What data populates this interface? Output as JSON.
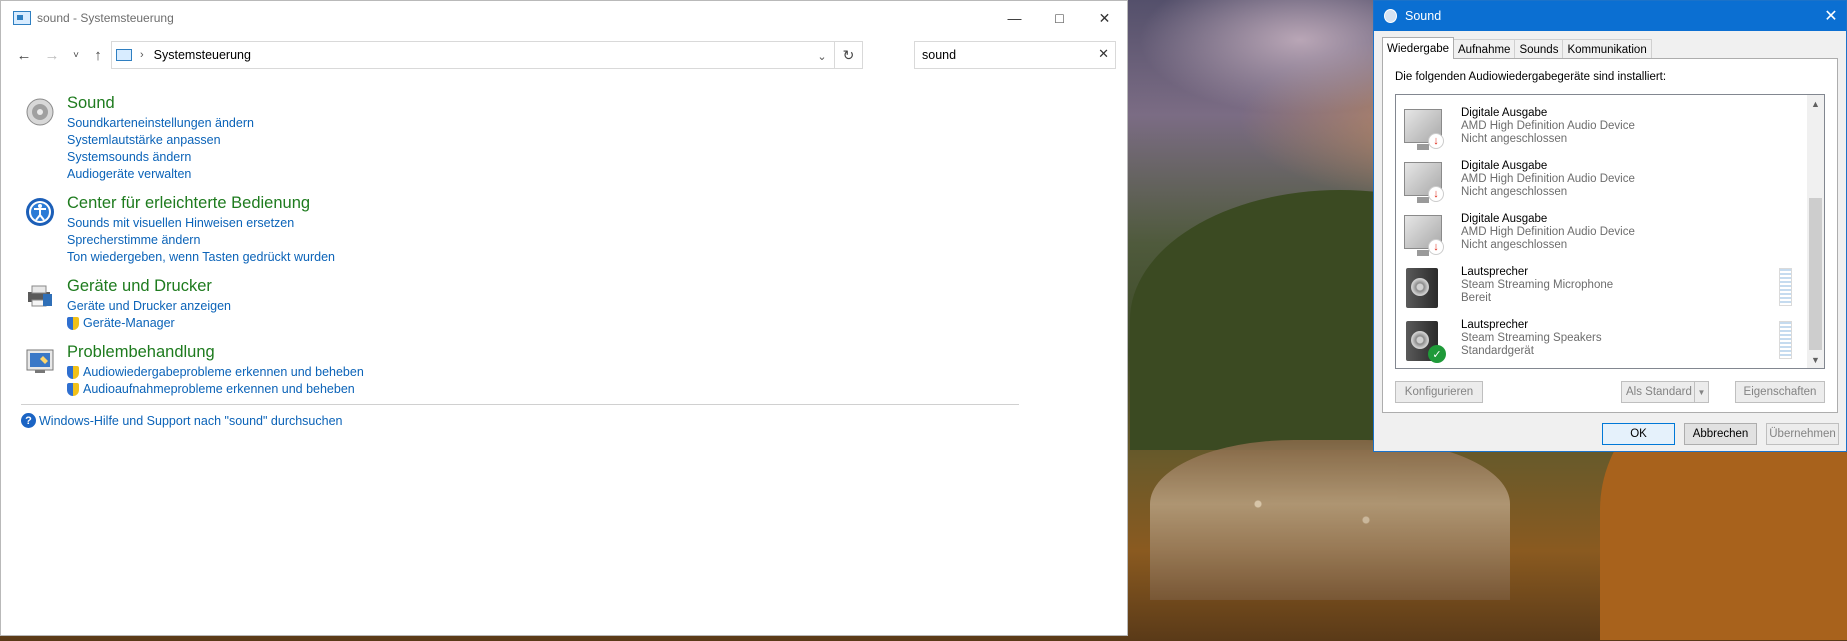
{
  "control_panel": {
    "title": "sound - Systemsteuerung",
    "address": {
      "path": "Systemsteuerung",
      "separator": "›"
    },
    "search": {
      "value": "sound"
    },
    "categories": [
      {
        "title": "Sound",
        "links": [
          {
            "label": "Soundkarteneinstellungen ändern",
            "shield": false
          },
          {
            "label": "Systemlautstärke anpassen",
            "shield": false
          },
          {
            "label": "Systemsounds ändern",
            "shield": false
          },
          {
            "label": "Audiogeräte verwalten",
            "shield": false
          }
        ]
      },
      {
        "title": "Center für erleichterte Bedienung",
        "links": [
          {
            "label": "Sounds mit visuellen Hinweisen ersetzen",
            "shield": false
          },
          {
            "label": "Sprecherstimme ändern",
            "shield": false
          },
          {
            "label": "Ton wiedergeben, wenn Tasten gedrückt wurden",
            "shield": false
          }
        ]
      },
      {
        "title": "Geräte und Drucker",
        "links": [
          {
            "label": "Geräte und Drucker anzeigen",
            "shield": false
          },
          {
            "label": "Geräte-Manager",
            "shield": true
          }
        ]
      },
      {
        "title": "Problembehandlung",
        "links": [
          {
            "label": "Audiowiedergabeprobleme erkennen und beheben",
            "shield": true
          },
          {
            "label": "Audioaufnahmeprobleme erkennen und beheben",
            "shield": true
          }
        ]
      }
    ],
    "help_link": "Windows-Hilfe und Support nach \"sound\" durchsuchen"
  },
  "sound_dialog": {
    "title": "Sound",
    "tabs": [
      "Wiedergabe",
      "Aufnahme",
      "Sounds",
      "Kommunikation"
    ],
    "active_tab": "Wiedergabe",
    "caption": "Die folgenden Audiowiedergabegeräte sind installiert:",
    "devices": [
      {
        "name": "Digitale Ausgabe",
        "driver": "AMD High Definition Audio Device",
        "status": "Nicht angeschlossen",
        "icon": "monitor-icon",
        "badge": "disconnected"
      },
      {
        "name": "Digitale Ausgabe",
        "driver": "AMD High Definition Audio Device",
        "status": "Nicht angeschlossen",
        "icon": "monitor-icon",
        "badge": "disconnected"
      },
      {
        "name": "Digitale Ausgabe",
        "driver": "AMD High Definition Audio Device",
        "status": "Nicht angeschlossen",
        "icon": "monitor-icon",
        "badge": "disconnected"
      },
      {
        "name": "Lautsprecher",
        "driver": "Steam Streaming Microphone",
        "status": "Bereit",
        "icon": "speaker-icon",
        "badge": "none"
      },
      {
        "name": "Lautsprecher",
        "driver": "Steam Streaming Speakers",
        "status": "Standardgerät",
        "icon": "speaker-icon",
        "badge": "default"
      }
    ],
    "buttons": {
      "configure": "Konfigurieren",
      "set_default": "Als Standard",
      "properties": "Eigenschaften",
      "ok": "OK",
      "cancel": "Abbrechen",
      "apply": "Übernehmen"
    }
  }
}
